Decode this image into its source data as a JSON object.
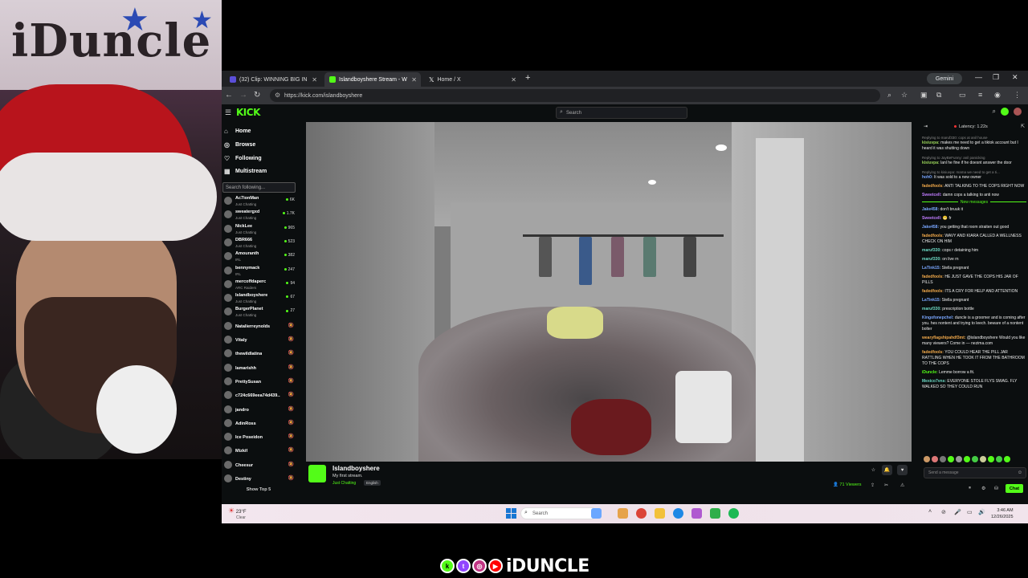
{
  "webcam": {
    "banner_text": "iDuncle"
  },
  "browser": {
    "tabs": [
      {
        "label": "(32) Clip: WINNING BIG IN",
        "favicon_color": "#5b4fd9",
        "active": false
      },
      {
        "label": "Islandboyshere Stream - W",
        "favicon_color": "#53fc18",
        "active": true
      },
      {
        "label": "Home / X",
        "favicon_color": "#ffffff",
        "active": false
      }
    ],
    "gemini_label": "Gemini",
    "url": "https://kick.com/islandboyshere"
  },
  "kick": {
    "logo": "KICK",
    "search_placeholder": "Search",
    "nav": [
      {
        "label": "Home",
        "icon": "home-icon",
        "glyph": "⌂"
      },
      {
        "label": "Browse",
        "icon": "compass-icon",
        "glyph": "◎"
      },
      {
        "label": "Following",
        "icon": "heart-icon",
        "glyph": "♡"
      },
      {
        "label": "Multistream",
        "icon": "grid-icon",
        "glyph": "▦"
      }
    ],
    "following_placeholder": "Search following...",
    "channels": [
      {
        "name": "Ac7ionMan",
        "category": "Just Chatting",
        "viewers": "6K",
        "live": true
      },
      {
        "name": "sweatergxd",
        "category": "Just Chatting",
        "viewers": "1.7K",
        "live": true
      },
      {
        "name": "NickLee",
        "category": "Just Chatting",
        "viewers": "965",
        "live": true
      },
      {
        "name": "DBR666",
        "category": "Just Chatting",
        "viewers": "523",
        "live": true
      },
      {
        "name": "Amouranth",
        "category": "IRL",
        "viewers": "382",
        "live": true
      },
      {
        "name": "bennymack",
        "category": "IRL",
        "viewers": "247",
        "live": true
      },
      {
        "name": "mercoffdaperc",
        "category": "ARC Raiders",
        "viewers": "94",
        "live": true
      },
      {
        "name": "Islandboyshere",
        "category": "Just Chatting",
        "viewers": "67",
        "live": true
      },
      {
        "name": "BurgerPlanet",
        "category": "Just Chatting",
        "viewers": "27",
        "live": true
      },
      {
        "name": "Natalierreynolds",
        "category": "",
        "viewers": "",
        "live": false
      },
      {
        "name": "Vitaly",
        "category": "",
        "viewers": "",
        "live": false
      },
      {
        "name": "thewildlatina",
        "category": "",
        "viewers": "",
        "live": false
      },
      {
        "name": "lamarishh",
        "category": "",
        "viewers": "",
        "live": false
      },
      {
        "name": "PrettySusan",
        "category": "",
        "viewers": "",
        "live": false
      },
      {
        "name": "c724c669eea74d439...",
        "category": "",
        "viewers": "",
        "live": false
      },
      {
        "name": "jandro",
        "category": "",
        "viewers": "",
        "live": false
      },
      {
        "name": "AdinRoss",
        "category": "",
        "viewers": "",
        "live": false
      },
      {
        "name": "Ice Poseidon",
        "category": "",
        "viewers": "",
        "live": false
      },
      {
        "name": "Mizkif",
        "category": "",
        "viewers": "",
        "live": false
      },
      {
        "name": "Cheesur",
        "category": "",
        "viewers": "",
        "live": false
      },
      {
        "name": "Destiny",
        "category": "",
        "viewers": "",
        "live": false
      }
    ],
    "show_top": "Show Top 5",
    "stream": {
      "name": "Islandboyshere",
      "title": "My first stream.",
      "category": "Just Chatting",
      "language": "English",
      "viewers": "71 Viewers"
    },
    "chat": {
      "latency": "Latency: 1.22s",
      "new_messages": "New messages",
      "messages": [
        {
          "reply": "Replying to maruf330: cops at anil house",
          "user": "kisiuvpa:",
          "color": "#9ad35a",
          "text": "makes me need to get a tiktok account but I heard it was shutting down"
        },
        {
          "reply": "Replying to JayBeFunny: anil panicking",
          "user": "kisiuvpa:",
          "color": "#9ad35a",
          "text": "lanl he fine if he doesnt answer the door"
        },
        {
          "reply": "Replying to kisiuvpa: mama we need to get a ti...",
          "user": "hoh0:",
          "color": "#7aa7ff",
          "text": "It was sold to a new owner"
        },
        {
          "reply": "",
          "user": "fadedfools:",
          "color": "#f0a84a",
          "text": "ANTI TALKING TO THE COPS RIGHT NOW"
        },
        {
          "reply": "",
          "user": "Sweetcell:",
          "color": "#c07cff",
          "text": "damn cops a talking to anti now"
        },
        {
          "reply": "",
          "user": "Jake458:",
          "color": "#7aa7ff",
          "text": "don't bruuk it",
          "after_new": true
        },
        {
          "reply": "",
          "user": "Sweetcell:",
          "color": "#c07cff",
          "text": "😬 fr"
        },
        {
          "reply": "",
          "user": "Jake458:",
          "color": "#7aa7ff",
          "text": "you getting that room straiten out good"
        },
        {
          "reply": "",
          "user": "fadedfools:",
          "color": "#f0a84a",
          "text": "WAVY AND KIARA CALLED A WELLNESS CHECK ON HIM"
        },
        {
          "reply": "",
          "user": "maruf330:",
          "color": "#6cd9c4",
          "text": "cops r detaining him"
        },
        {
          "reply": "",
          "user": "maruf330:",
          "color": "#6cd9c4",
          "text": "on live rn"
        },
        {
          "reply": "",
          "user": "LaTink15:",
          "color": "#7aa7ff",
          "text": "Stella pregnant"
        },
        {
          "reply": "",
          "user": "fadedfools:",
          "color": "#f0a84a",
          "text": "HE JUST GAVE THE COPS HIS JAR OF PILLS"
        },
        {
          "reply": "",
          "user": "fadedfools:",
          "color": "#f0a84a",
          "text": "ITS A CRY FOR HELP AND ATTENTION"
        },
        {
          "reply": "",
          "user": "LaTink15:",
          "color": "#7aa7ff",
          "text": "Stella pregnant"
        },
        {
          "reply": "",
          "user": "maruf330:",
          "color": "#6cd9c4",
          "text": "prescription bottle"
        },
        {
          "reply": "",
          "user": "Kingofonepchel:",
          "color": "#7aa7ff",
          "text": "duncle is a groomer and is coming after you. hes nontent and trying to leech. beware of a nontent bolter"
        },
        {
          "reply": "",
          "user": "wearyflagshipahdf3mt:",
          "color": "#f0a84a",
          "text": "@islandboyshere Would you like many viewers? Come in — nezima.com"
        },
        {
          "reply": "",
          "user": "fadedfools:",
          "color": "#f0a84a",
          "text": "YOU COULD HEAR THE PILL JAR RATTLING WHEN HE TOOK IT FROM THE BATHROOM TO THE COPS"
        },
        {
          "reply": "",
          "user": "iDuncle:",
          "color": "#53fc18",
          "text": "Lemme borrow a fit."
        },
        {
          "reply": "",
          "user": "Mexico7vns:",
          "color": "#6cd9c4",
          "text": "EVERYONE STOLE FLYS SWAG. FLY WALKED SO THEY COULD RUN"
        }
      ],
      "input_placeholder": "Send a message",
      "send_label": "Chat"
    }
  },
  "taskbar": {
    "temp": "23°F",
    "condition": "Clear",
    "search_placeholder": "Search",
    "time": "3:46 AM",
    "date": "12/26/2025"
  },
  "socials": {
    "handle": "iDUNCLE"
  }
}
